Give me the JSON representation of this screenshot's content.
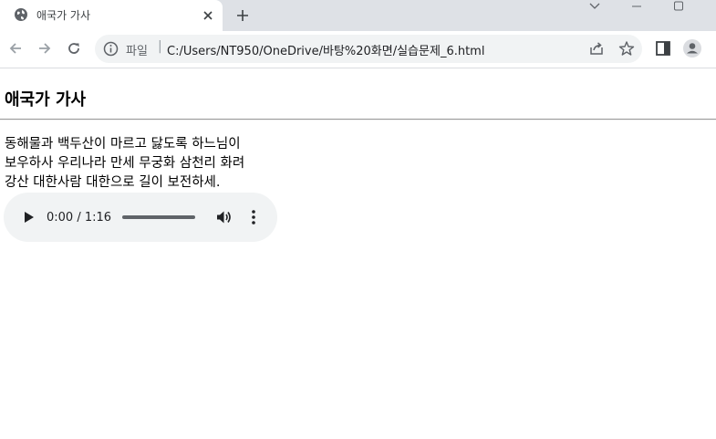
{
  "browser": {
    "tab": {
      "title": "애국가 가사"
    },
    "address_bar": {
      "scheme_label": "파일",
      "url": "C:/Users/NT950/OneDrive/바탕%20화면/실습문제_6.html"
    }
  },
  "page": {
    "heading": "애국가 가사",
    "lyrics": [
      "동해물과 백두산이 마르고 닳도록 하느님이",
      "보우하사 우리나라 만세 무궁화 삼천리 화려",
      "강산 대한사람 대한으로 길이 보전하세."
    ],
    "audio": {
      "time": "0:00 / 1:16",
      "progress": 0
    }
  },
  "colors": {
    "tabstrip": "#dee1e6",
    "omnibox": "#f1f3f4",
    "icon": "#5f6368",
    "audio_bg": "#f1f3f4"
  }
}
